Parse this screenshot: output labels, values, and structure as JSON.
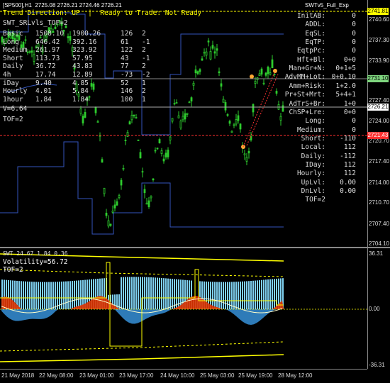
{
  "header": {
    "symbol_line": "[SP500],H1  2725.08 2726.21 2724.46 2726.21",
    "window_title": "SWTv5_Full_Exp",
    "trend_line": "Trend Direction: UP  |  Ready to Trade: Not Ready",
    "indicator_name": "SWT_SRLvls_TOF=2"
  },
  "stats_table": {
    "rows": [
      {
        "label": "Basic",
        "c1": "1508.10",
        "c2": "1900.26",
        "c3": "126",
        "c4": "2"
      },
      {
        "label": "Long",
        "c1": "646.42",
        "c2": "392.16",
        "c3": "61",
        "c4": "-1"
      },
      {
        "label": "Medium",
        "c1": "261.97",
        "c2": "323.92",
        "c3": "122",
        "c4": "2"
      },
      {
        "label": "Short",
        "c1": "113.73",
        "c2": "57.95",
        "c3": "43",
        "c4": "-1"
      },
      {
        "label": "Daily",
        "c1": "36.72",
        "c2": "43.83",
        "c3": "77",
        "c4": "2"
      },
      {
        "label": "4h",
        "c1": "17.74",
        "c2": "12.89",
        "c3": "-73",
        "c4": "-2"
      },
      {
        "label": "iDay",
        "c1": "9.40",
        "c2": "4.85",
        "c3": "52",
        "c4": "1"
      },
      {
        "label": "Hourly",
        "c1": "4.01",
        "c2": "5.84",
        "c3": "146",
        "c4": "2"
      },
      {
        "label": "1hour",
        "c1": "1.84",
        "c2": "1.84",
        "c3": "100",
        "c4": "1"
      }
    ],
    "v_line": "V=6.64",
    "tof_line": "TOF=2"
  },
  "hud_right": [
    {
      "label": "InitAB:",
      "value": "0"
    },
    {
      "label": "ADDL:",
      "value": "0"
    },
    {
      "label": "EqSL:",
      "value": "0"
    },
    {
      "label": "EqTP:",
      "value": "0"
    },
    {
      "label": "EqtpPc:",
      "value": "0"
    },
    {
      "label": "Hft+Bl:",
      "value": "0+0"
    },
    {
      "label": "Man+Gr+N:",
      "value": "0+1+5"
    },
    {
      "label": "AdvMM+Lot:",
      "value": "0+0.10"
    },
    {
      "label": "Amm+Risk:",
      "value": "1+2.0"
    },
    {
      "label": "Pr+St+Mrt:",
      "value": "5+4+1"
    },
    {
      "label": "AdTrS+Br:",
      "value": "1+0"
    },
    {
      "label": "ChSP+Lre:",
      "value": "0+0"
    },
    {
      "label": "Long:",
      "value": "0"
    },
    {
      "label": "Medium:",
      "value": "0"
    },
    {
      "label": "Short:",
      "value": "-110"
    },
    {
      "label": "Local:",
      "value": "112"
    },
    {
      "label": "Daily:",
      "value": "-112"
    },
    {
      "label": "IDay:",
      "value": "112"
    },
    {
      "label": "Hourly:",
      "value": "112"
    },
    {
      "label": "UpLvl:",
      "value": "0.00"
    },
    {
      "label": "DnLvl:",
      "value": "0.00"
    },
    {
      "label": "TOF=2",
      "value": ""
    }
  ],
  "price_axis": {
    "ticks": [
      "2740.60",
      "2737.30",
      "2733.90",
      "2727.40",
      "2724.00",
      "2720.70",
      "2717.40",
      "2714.00",
      "2710.70",
      "2707.40",
      "2704.10"
    ],
    "badges": [
      {
        "text": "2741.81",
        "bg": "#ffff00"
      },
      {
        "text": "2731.10",
        "bg": "#7fd67f"
      },
      {
        "text": "2726.21",
        "bg": "#ffffff"
      },
      {
        "text": "2721.43",
        "bg": "#ff3030"
      }
    ]
  },
  "indicator": {
    "title": "SWT 24.67 1.84 0.36",
    "volatility": "Volatility=56.72",
    "tof": "TOF=2",
    "axis_top": "36.31",
    "axis_mid": "0.00",
    "axis_bot": "-36.31"
  },
  "time_axis": [
    "21 May 2018",
    "22 May 08:00",
    "23 May 01:00",
    "23 May 17:00",
    "24 May 10:00",
    "25 May 03:00",
    "25 May 19:00",
    "28 May 12:00"
  ],
  "colors": {
    "bull": "#33dd33",
    "bear": "#33dd33",
    "level": "#4466cc",
    "accent": "#ffff00",
    "hist_blue": "#3388cc",
    "hist_red": "#dd3300",
    "hist_cyan": "#7fd0f0"
  }
}
